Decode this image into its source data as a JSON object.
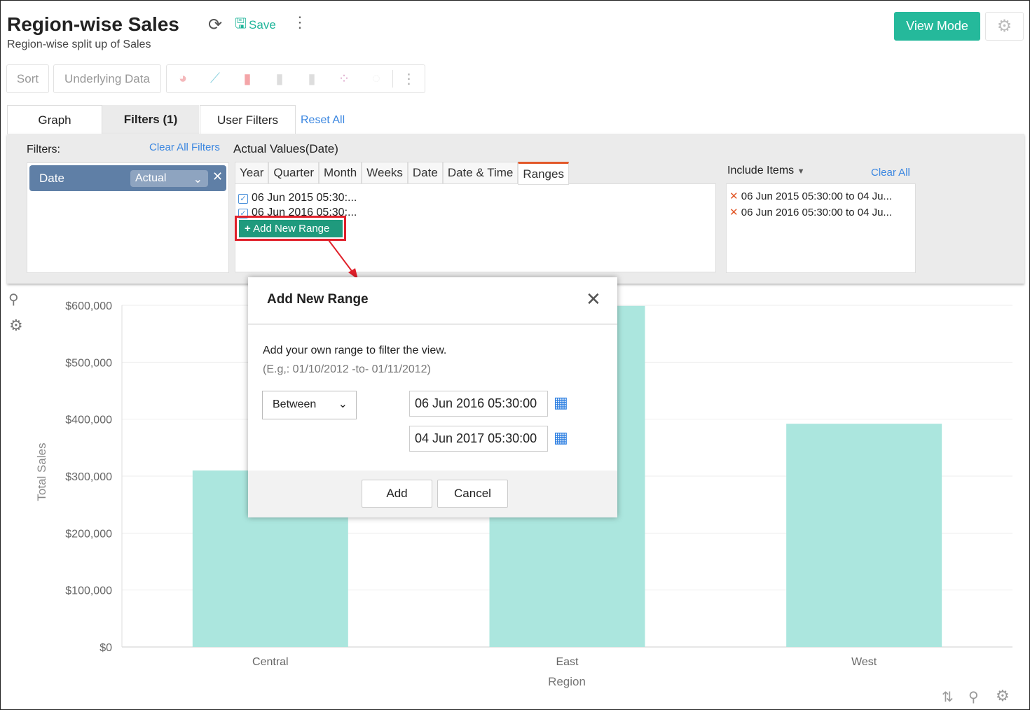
{
  "header": {
    "title": "Region-wise Sales",
    "subtitle": "Region-wise split up of Sales",
    "save_label": "Save",
    "view_mode_label": "View Mode"
  },
  "toolbar": {
    "sort_label": "Sort",
    "underlying_data_label": "Underlying Data",
    "chart_types": [
      "pie-chart-icon",
      "line-chart-icon",
      "bar-chart-icon",
      "stacked-bar-icon",
      "grouped-bar-icon",
      "scatter-icon",
      "map-icon"
    ]
  },
  "tabs": [
    {
      "label": "Graph"
    },
    {
      "label": "Filters (1)",
      "active": true
    },
    {
      "label": "User Filters"
    }
  ],
  "reset_all_label": "Reset All",
  "filters": {
    "label": "Filters:",
    "clear_all_label": "Clear All Filters",
    "field": "Date",
    "field_mode": "Actual",
    "values_title": "Actual Values(Date)",
    "date_tabs": [
      "Year",
      "Quarter",
      "Month",
      "Weeks",
      "Date",
      "Date & Time",
      "Ranges"
    ],
    "active_date_tab": "Ranges",
    "ranges": [
      "06 Jun 2015 05:30:...",
      "06 Jun 2016 05:30:..."
    ],
    "add_range_label": "Add New Range",
    "include_label": "Include Items",
    "clear_label": "Clear All",
    "included": [
      "06 Jun 2015 05:30:00 to 04 Ju...",
      "06 Jun 2016 05:30:00 to 04 Ju..."
    ]
  },
  "modal": {
    "title": "Add New Range",
    "description": "Add your own range to filter the view.",
    "example": "(E.g,: 01/10/2012 -to- 01/11/2012)",
    "operator": "Between",
    "from": "06 Jun  2016 05:30:00",
    "to": "04 Jun  2017 05:30:00",
    "add_label": "Add",
    "cancel_label": "Cancel"
  },
  "chart_data": {
    "type": "bar",
    "categories": [
      "Central",
      "East",
      "West"
    ],
    "values": [
      310000,
      599000,
      392000
    ],
    "xlabel": "Region",
    "ylabel": "Total Sales",
    "ylim": [
      0,
      600000
    ],
    "yticks": [
      "$0",
      "$100,000",
      "$200,000",
      "$300,000",
      "$400,000",
      "$500,000",
      "$600,000"
    ],
    "grid": true,
    "color": "#abe6de"
  }
}
